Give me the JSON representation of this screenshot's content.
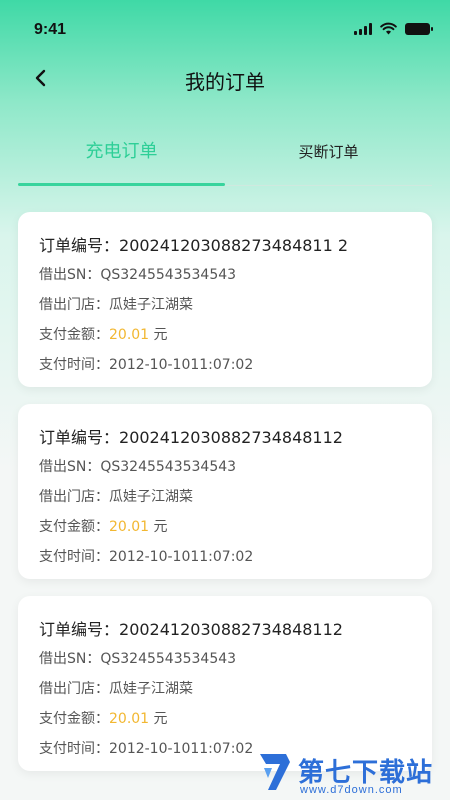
{
  "status_bar": {
    "time": "9:41"
  },
  "header": {
    "title": "我的订单"
  },
  "tabs": [
    {
      "label": "充电订单",
      "active": true
    },
    {
      "label": "买断订单",
      "active": false
    }
  ],
  "orders": [
    {
      "order_no_label": "订单编号：",
      "order_no": "200241203088273484811 2",
      "sn_label": "借出SN：",
      "sn": "QS3245543534543",
      "store_label": "借出门店：",
      "store": "瓜娃子江湖菜",
      "amount_label": "支付金额：",
      "amount": "20.01",
      "amount_unit": " 元",
      "time_label": "支付时间：",
      "time": "2012-10-1011:07:02"
    },
    {
      "order_no_label": "订单编号：",
      "order_no": "2002412030882734848112",
      "sn_label": "借出SN：",
      "sn": "QS3245543534543",
      "store_label": "借出门店：",
      "store": "瓜娃子江湖菜",
      "amount_label": "支付金额：",
      "amount": "20.01",
      "amount_unit": " 元",
      "time_label": "支付时间：",
      "time": "2012-10-1011:07:02"
    },
    {
      "order_no_label": "订单编号：",
      "order_no": "2002412030882734848112",
      "sn_label": "借出SN：",
      "sn": "QS3245543534543",
      "store_label": "借出门店：",
      "store": "瓜娃子江湖菜",
      "amount_label": "支付金额：",
      "amount": "20.01",
      "amount_unit": " 元",
      "time_label": "支付时间：",
      "time": "2012-10-1011:07:02"
    }
  ],
  "watermark": {
    "name": "第七下载站",
    "url": "www.d7down.com"
  },
  "colors": {
    "accent": "#2ecf97",
    "amount": "#f2b731",
    "watermark": "#2d6fd8"
  },
  "icons": {
    "back": "chevron-left-icon",
    "signal": "cellular-signal-icon",
    "wifi": "wifi-icon",
    "battery": "battery-icon"
  }
}
